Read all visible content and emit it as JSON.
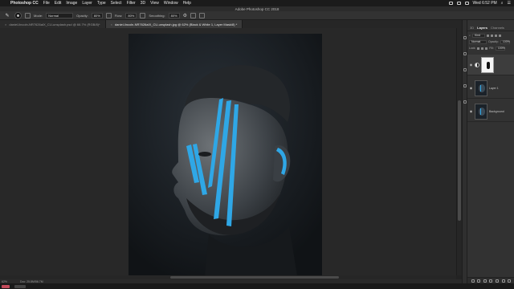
{
  "menubar": {
    "app_name": "Photoshop CC",
    "items": [
      "File",
      "Edit",
      "Image",
      "Layer",
      "Type",
      "Select",
      "Filter",
      "3D",
      "View",
      "Window",
      "Help"
    ],
    "clock": "Wed 6:52 PM"
  },
  "window": {
    "title": "Adobe Photoshop CC 2018"
  },
  "options_bar": {
    "mode_label": "Mode:",
    "mode_value": "Normal",
    "opacity_label": "Opacity:",
    "opacity_value": "80%",
    "flow_label": "Flow:",
    "flow_value": "80%",
    "smoothing_label": "Smoothing:",
    "smoothing_value": "80%"
  },
  "tabs": [
    {
      "label": "daniel-lincoln-NR7626aIX_CU-unsplash.psd @ 66.7% (RGB/8)*",
      "active": false
    },
    {
      "label": "daniel-lincoln-NR7626aIX_CU-unsplash.jpg @ 62% (Black & White 1, Layer Mask/8) *",
      "active": true
    }
  ],
  "status": {
    "zoom": "62%",
    "doc": "Doc: 25.8M/56.7M"
  },
  "panel": {
    "tabs": [
      "3D",
      "Layers",
      "Channels"
    ],
    "active_tab": "Layers",
    "filter_value": "Kind",
    "blend_value": "Normal",
    "opacity_label": "Opacity:",
    "opacity_value": "100%",
    "lock_label": "Lock:",
    "fill_label": "Fill:",
    "fill_value": "100%",
    "layers": [
      {
        "name": "",
        "type": "adjustment"
      },
      {
        "name": "Layer 1",
        "type": "pixel"
      },
      {
        "name": "Background",
        "type": "pixel"
      }
    ]
  },
  "colors": {
    "accent_stripe": "#2fa7e6",
    "ui_dark": "#232323",
    "panel": "#323232"
  }
}
